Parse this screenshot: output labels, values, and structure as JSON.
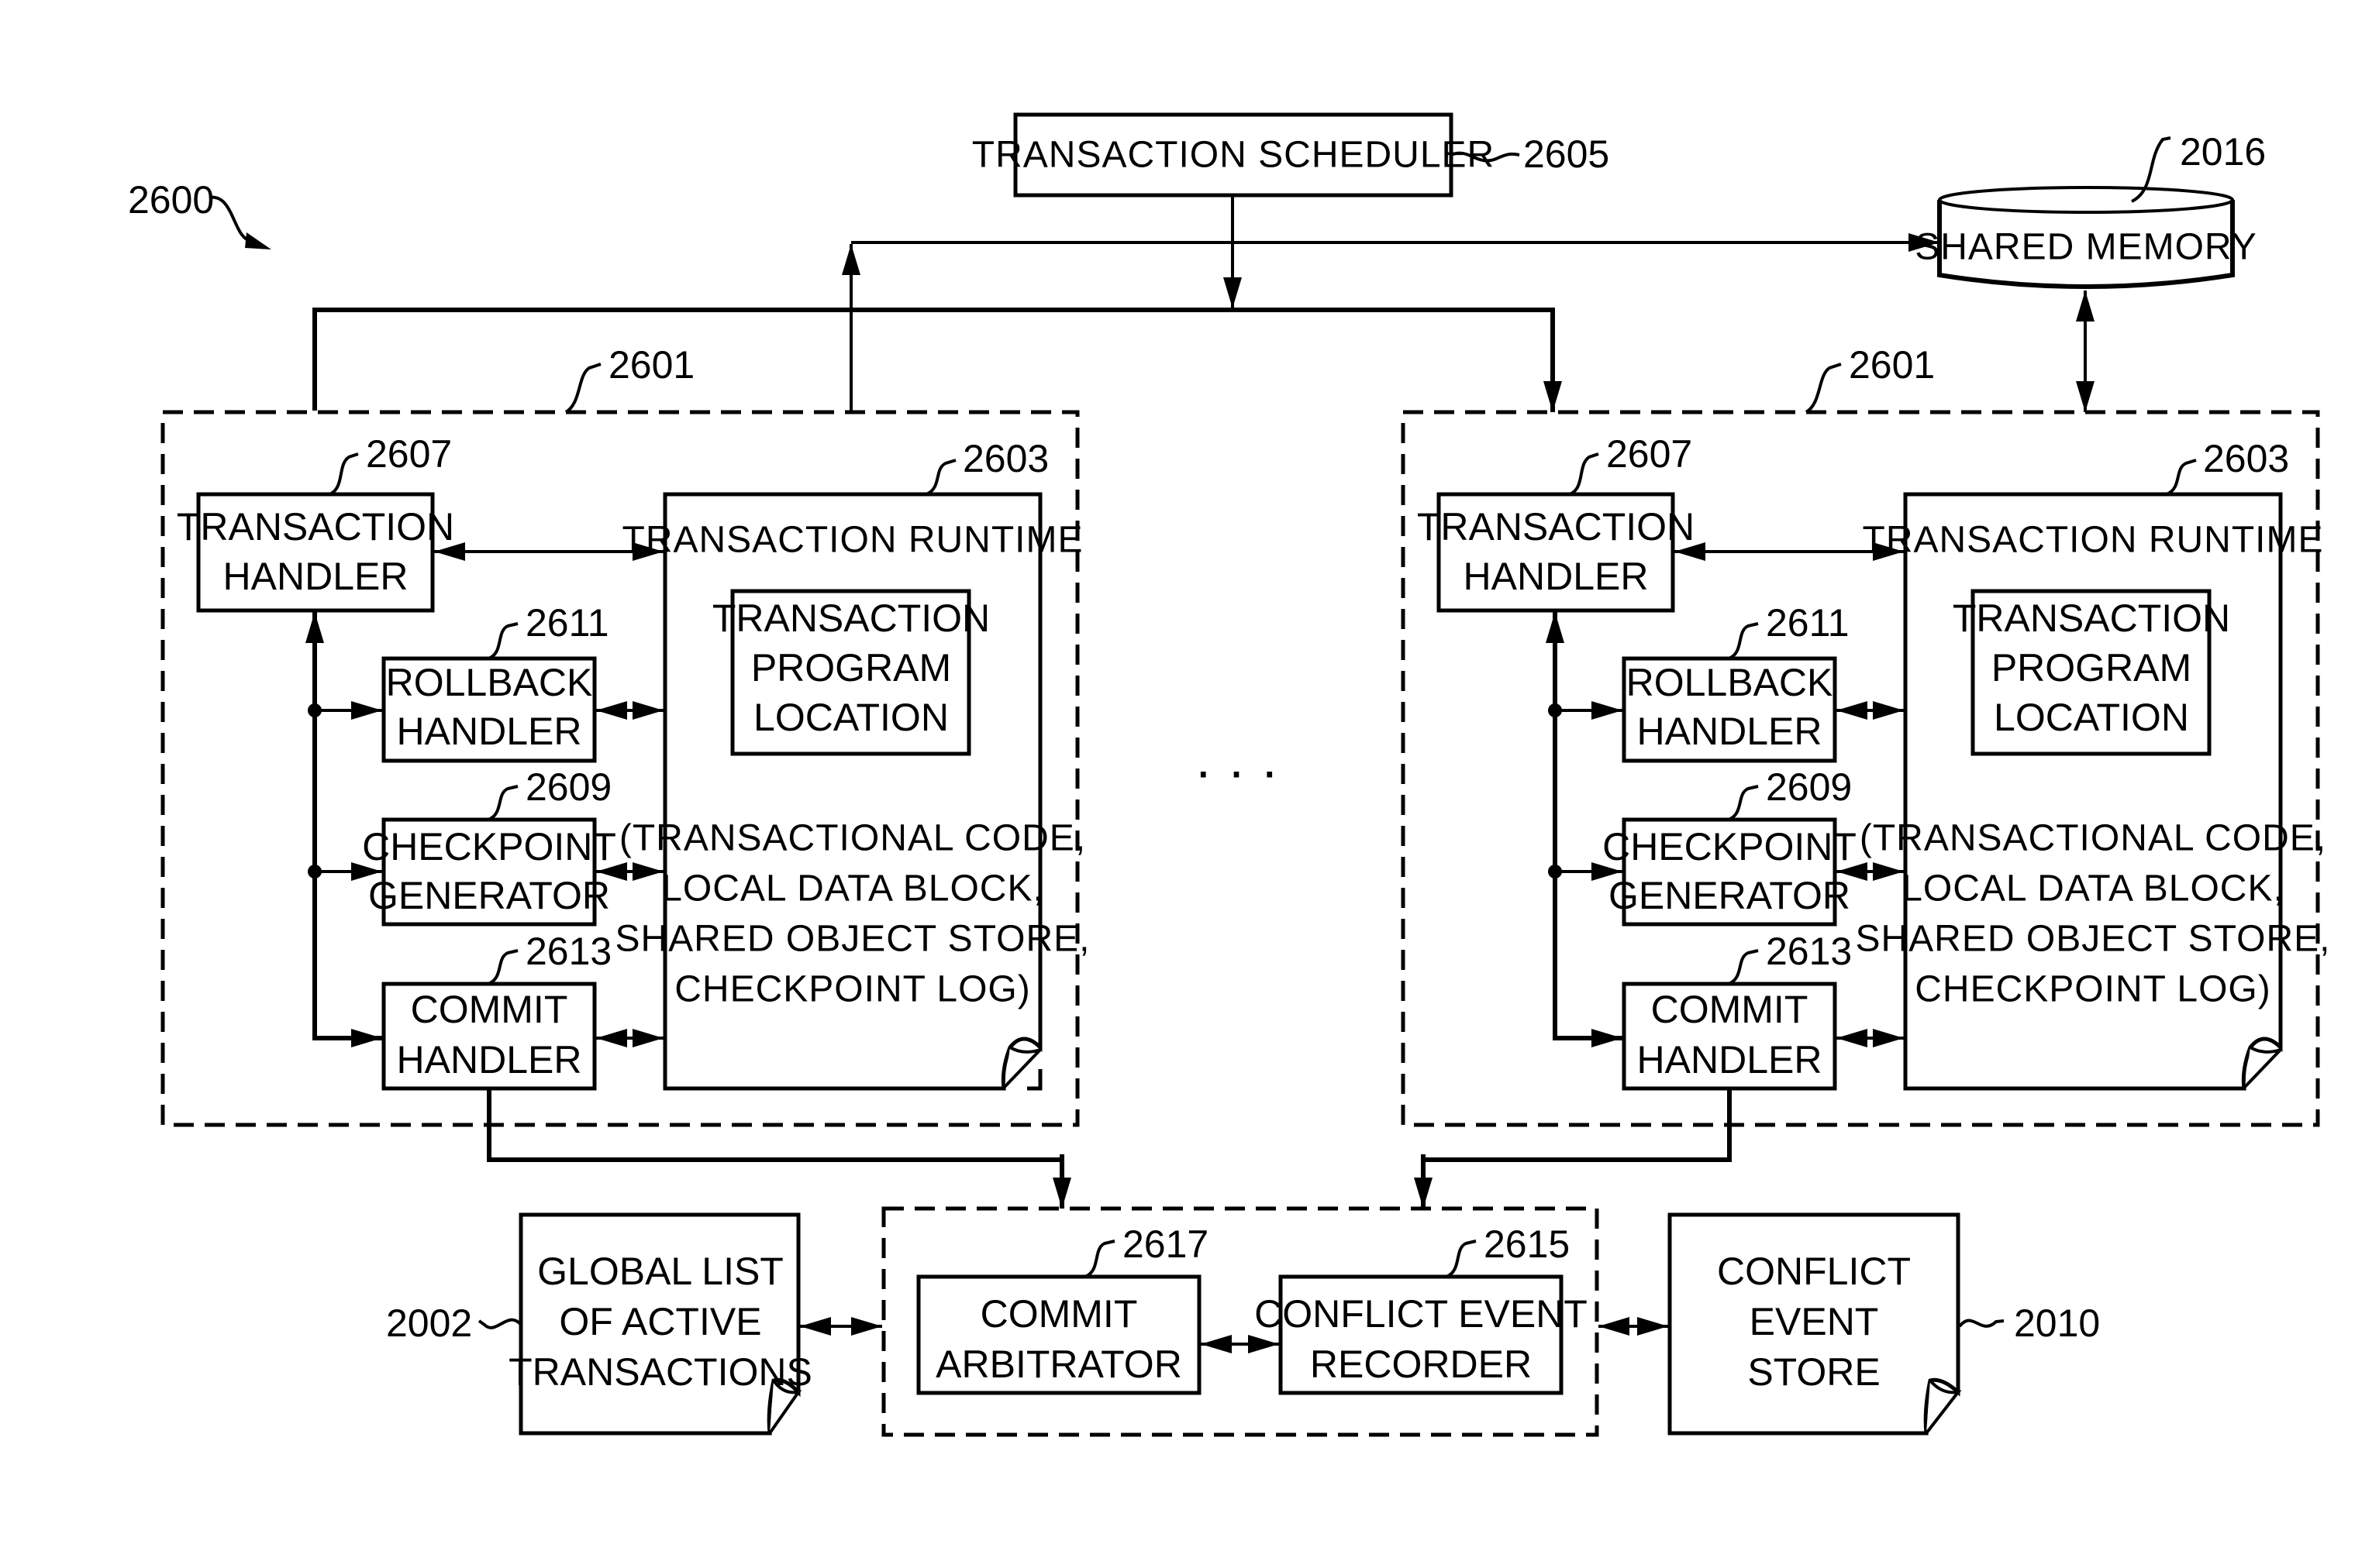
{
  "figure": {
    "ref": "2600"
  },
  "scheduler": {
    "label": "TRANSACTION SCHEDULER",
    "ref": "2605"
  },
  "shared_memory": {
    "label": "SHARED MEMORY",
    "ref": "2016"
  },
  "ellipsis": "· · ·",
  "node_groups": [
    {
      "ref": "2601",
      "transaction_handler": {
        "lines": [
          "TRANSACTION",
          "HANDLER"
        ],
        "ref": "2607"
      },
      "rollback_handler": {
        "lines": [
          "ROLLBACK",
          "HANDLER"
        ],
        "ref": "2611"
      },
      "checkpoint_generator": {
        "lines": [
          "CHECKPOINT",
          "GENERATOR"
        ],
        "ref": "2609"
      },
      "commit_handler": {
        "lines": [
          "COMMIT",
          "HANDLER"
        ],
        "ref": "2613"
      },
      "runtime": {
        "title": "TRANSACTION RUNTIME",
        "ref": "2603",
        "program_location": [
          "TRANSACTION",
          "PROGRAM",
          "LOCATION"
        ],
        "contents": [
          "(TRANSACTIONAL CODE,",
          "LOCAL DATA BLOCK,",
          "SHARED OBJECT STORE,",
          "CHECKPOINT LOG)"
        ]
      }
    },
    {
      "ref": "2601",
      "transaction_handler": {
        "lines": [
          "TRANSACTION",
          "HANDLER"
        ],
        "ref": "2607"
      },
      "rollback_handler": {
        "lines": [
          "ROLLBACK",
          "HANDLER"
        ],
        "ref": "2611"
      },
      "checkpoint_generator": {
        "lines": [
          "CHECKPOINT",
          "GENERATOR"
        ],
        "ref": "2609"
      },
      "commit_handler": {
        "lines": [
          "COMMIT",
          "HANDLER"
        ],
        "ref": "2613"
      },
      "runtime": {
        "title": "TRANSACTION RUNTIME",
        "ref": "2603",
        "program_location": [
          "TRANSACTION",
          "PROGRAM",
          "LOCATION"
        ],
        "contents": [
          "(TRANSACTIONAL CODE,",
          "LOCAL DATA BLOCK,",
          "SHARED OBJECT STORE,",
          "CHECKPOINT LOG)"
        ]
      }
    }
  ],
  "global_list": {
    "lines": [
      "GLOBAL LIST",
      "OF ACTIVE",
      "TRANSACTIONS"
    ],
    "ref": "2002"
  },
  "commit_arbitrator": {
    "lines": [
      "COMMIT",
      "ARBITRATOR"
    ],
    "ref": "2617"
  },
  "conflict_event_recorder": {
    "lines": [
      "CONFLICT EVENT",
      "RECORDER"
    ],
    "ref": "2615"
  },
  "conflict_event_store": {
    "lines": [
      "CONFLICT",
      "EVENT",
      "STORE"
    ],
    "ref": "2010"
  }
}
